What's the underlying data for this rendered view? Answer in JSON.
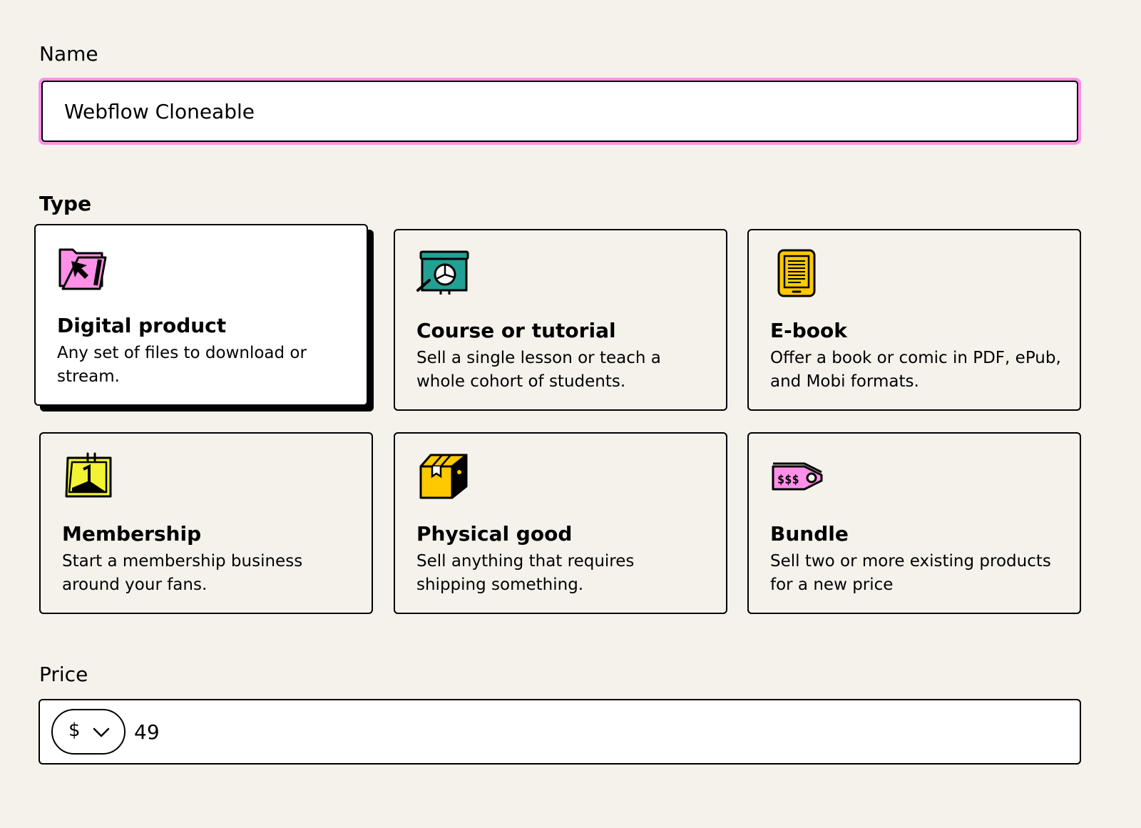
{
  "name": {
    "label": "Name",
    "value": "Webflow Cloneable"
  },
  "type": {
    "label": "Type",
    "options": [
      {
        "title": "Digital product",
        "description": "Any set of files to download or stream.",
        "icon": "folder-cursor-icon",
        "selected": true
      },
      {
        "title": "Course or tutorial",
        "description": "Sell a single lesson or teach a whole cohort of students.",
        "icon": "presentation-board-icon",
        "selected": false
      },
      {
        "title": "E-book",
        "description": "Offer a book or comic in PDF, ePub, and Mobi formats.",
        "icon": "ereader-icon",
        "selected": false
      },
      {
        "title": "Membership",
        "description": "Start a membership business around your fans.",
        "icon": "calendar-icon",
        "selected": false
      },
      {
        "title": "Physical good",
        "description": "Sell anything that requires shipping something.",
        "icon": "package-box-icon",
        "selected": false
      },
      {
        "title": "Bundle",
        "description": "Sell two or more existing products for a new price",
        "icon": "price-tag-icon",
        "selected": false
      }
    ]
  },
  "price": {
    "label": "Price",
    "currency": "$",
    "value": "49"
  },
  "colors": {
    "accent_pink": "#ff90e8",
    "teal": "#23a094",
    "yellow": "#ffc900",
    "bright_yellow": "#f1f333",
    "background": "#f5f2ec"
  }
}
